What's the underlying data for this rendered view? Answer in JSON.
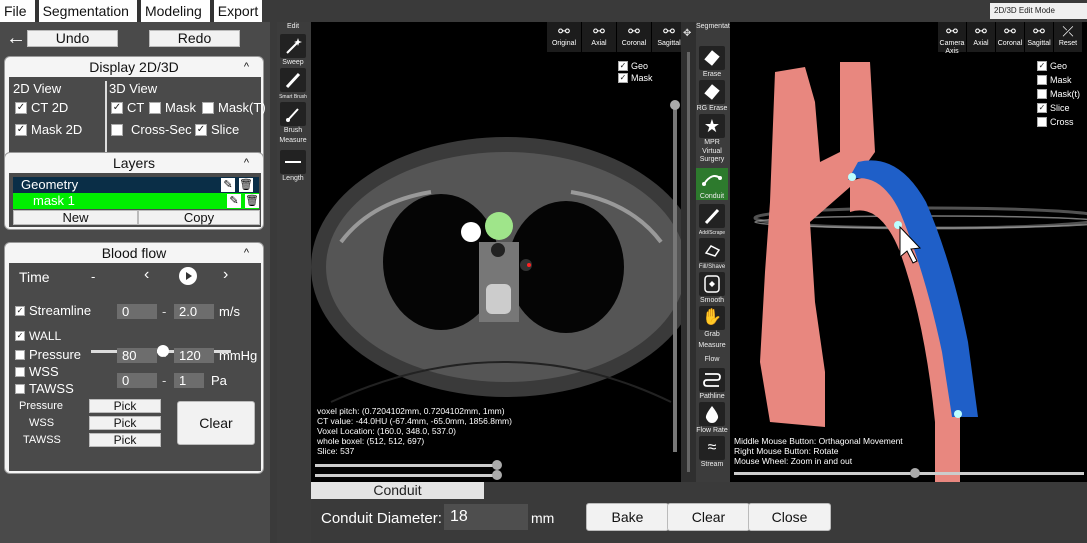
{
  "menu": [
    "File",
    "Segmentation",
    "Modeling",
    "Export"
  ],
  "mode_label": "2D/3D Edit Mode",
  "toolbar": {
    "undo": "Undo",
    "redo": "Redo"
  },
  "display": {
    "title": "Display 2D/3D",
    "col2d": "2D View",
    "col3d": "3D View",
    "ct2d": "CT 2D",
    "mask2d": "Mask 2D",
    "ct": "CT",
    "mask": "Mask",
    "maskt": "Mask(T)",
    "crosssec": "Cross-Sec",
    "slice": "Slice"
  },
  "layers": {
    "title": "Layers",
    "geometry": "Geometry",
    "mask1": "mask 1",
    "new": "New",
    "copy": "Copy"
  },
  "bloodflow": {
    "title": "Blood flow",
    "time": "Time",
    "time_dash": "-",
    "streamline": "Streamline",
    "stream_min": "0",
    "stream_max": "2.0",
    "stream_unit": "m/s",
    "wall": "WALL",
    "pressure": "Pressure",
    "press_min": "80",
    "press_max": "120",
    "press_unit": "mmHg",
    "wss": "WSS",
    "tawss": "TAWSS",
    "tawss_min": "0",
    "tawss_max": "1",
    "tawss_unit": "Pa",
    "pick_pressure": "Pressure",
    "pick_wss": "WSS",
    "pick_tawss": "TAWSS",
    "pick": "Pick",
    "clear": "Clear",
    "range_dash": "-"
  },
  "edit_tools": {
    "title": "Edit",
    "sweep": "Sweep",
    "smart_brush": "Smart Brush",
    "brush": "Brush",
    "measure": "Measure",
    "length": "Length"
  },
  "seg_tools": {
    "title": "Segmentation",
    "erase": "Erase",
    "rg_erase": "RG Erase",
    "mpr": "MPR",
    "virtual_surgery": "Virtual Surgery",
    "conduit": "Conduit",
    "add_scrape": "Add/Scrape",
    "fill_shave": "Fill/Shave",
    "smooth": "Smooth",
    "grab": "Grab",
    "measure": "Measure",
    "flow": "Flow",
    "pathline": "Pathline",
    "flow_rate": "Flow Rate",
    "stream": "Stream"
  },
  "view2d": {
    "buttons": [
      "Original",
      "Axial",
      "Coronal",
      "Sagittal"
    ],
    "geo": "Geo",
    "mask": "Mask",
    "info": [
      "voxel pitch: (0.7204102mm, 0.7204102mm, 1mm)",
      "CT value:  -44.0HU (-67.4mm, -65.0mm, 1856.8mm)",
      "Voxel Location: (160.0, 348.0, 537.0)",
      "whole boxel:     (512, 512, 697)",
      "Slice: 537"
    ]
  },
  "view3d": {
    "buttons": [
      "Camera Axis",
      "Axial",
      "Coronal",
      "Sagittal",
      "Reset"
    ],
    "checks": [
      "Geo",
      "Mask",
      "Mask(t)",
      "Slice",
      "Cross"
    ],
    "help": [
      "Middle Mouse Button: Orthagonal Movement",
      "Right Mouse Button: Rotate",
      "Mouse Wheel: Zoom in and out"
    ]
  },
  "conduit": {
    "tab": "Conduit",
    "diameter_label": "Conduit Diameter:",
    "diameter": "18",
    "unit": "mm",
    "bake": "Bake",
    "clear": "Clear",
    "close": "Close"
  },
  "colors": {
    "mask_green": "#00ee00",
    "geometry_blue": "#0a2e47",
    "vessel": "#e8877f",
    "conduit": "#1f5fc8"
  }
}
